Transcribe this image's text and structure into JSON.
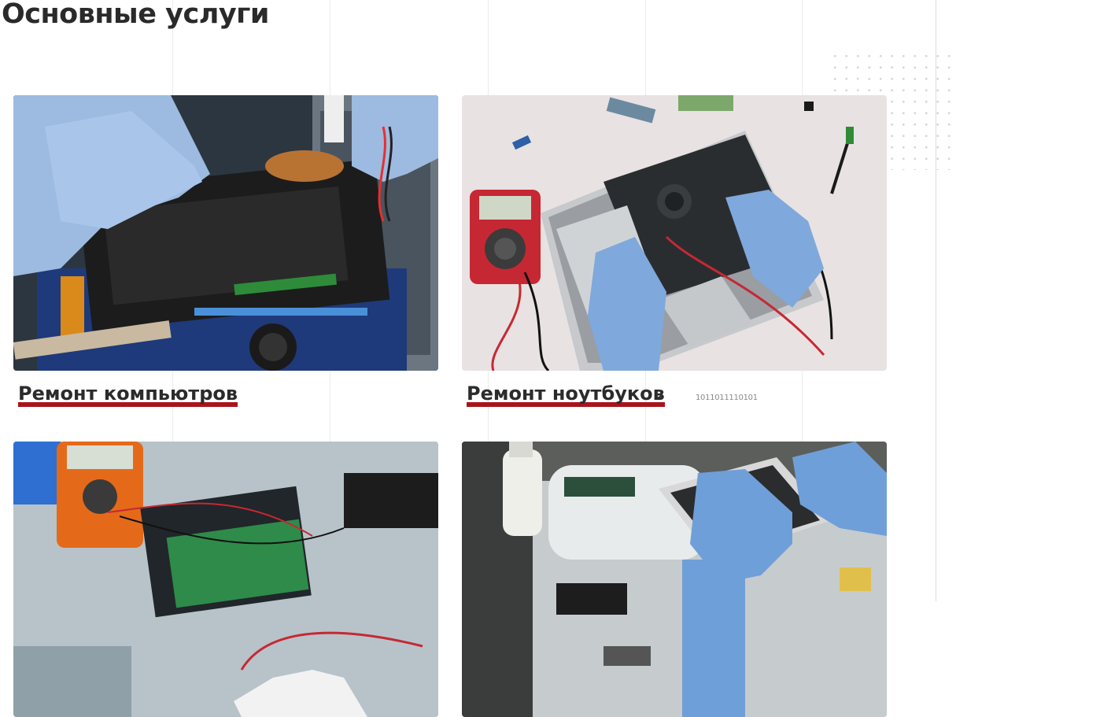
{
  "section": {
    "title": "Основные услуги"
  },
  "services": [
    {
      "title": "Ремонт компьютров",
      "photo_icon": "pc-repair-photo"
    },
    {
      "title": "Ремонт ноутбуков",
      "photo_icon": "laptop-repair-photo"
    },
    {
      "title": "",
      "photo_icon": "tv-repair-photo"
    },
    {
      "title": "",
      "photo_icon": "phone-repair-photo"
    }
  ],
  "decor": {
    "binary_text": "1011011110101",
    "arrow_glyph": "◂",
    "accent_color": "#a8141a"
  }
}
